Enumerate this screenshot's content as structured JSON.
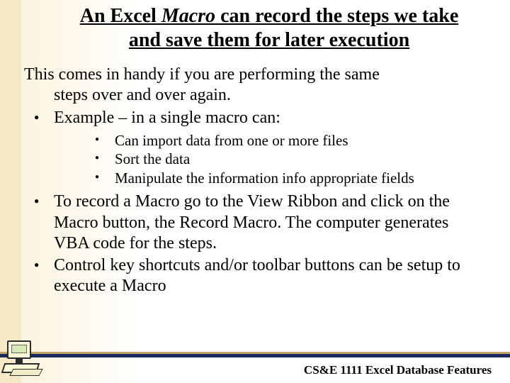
{
  "title": {
    "part1": "An Excel ",
    "macro": "Macro",
    "part2": " can record the steps we take and save them for later execution"
  },
  "intro": {
    "line1": "This comes in handy if you are performing the same",
    "line2": "steps over and over again."
  },
  "bullets1": [
    "Example – in a single macro can:"
  ],
  "sub_bullets": [
    "Can import data from one or more files",
    "Sort the data",
    "Manipulate the information info appropriate fields"
  ],
  "bullets2": [
    "To record a Macro go to the View Ribbon and click on the Macro button, the Record Macro.  The computer generates VBA code for the steps.",
    "Control key shortcuts and/or toolbar buttons can be setup to execute a Macro"
  ],
  "footer": "CS&E 1111 Excel Database Features"
}
